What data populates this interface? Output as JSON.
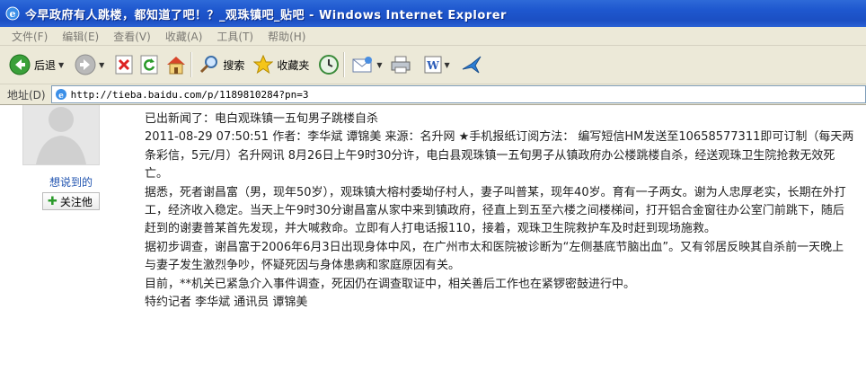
{
  "window": {
    "title": "今早政府有人跳楼，都知道了吧！？_观珠镇吧_贴吧 - Windows Internet Explorer"
  },
  "menu": [
    "文件(F)",
    "编辑(E)",
    "查看(V)",
    "收藏(A)",
    "工具(T)",
    "帮助(H)"
  ],
  "toolbar": {
    "back_label": "后退",
    "search_label": "搜索",
    "favorites_label": "收藏夹"
  },
  "address": {
    "label": "地址(D)",
    "url": "http://tieba.baidu.com/p/1189810284?pn=3"
  },
  "user": {
    "name": "想说到的",
    "follow_label": "关注他"
  },
  "post": {
    "lines": [
      "已出新闻了：电白观珠镇一五旬男子跳楼自杀",
      "2011-08-29 07:50:51 作者：李华斌 谭锦美 来源：名升网 ★手机报纸订阅方法： 编写短信HM发送至10658577311即可订制（每天两条彩信，5元/月）名升网讯 8月26日上午9时30分许，电白县观珠镇一五旬男子从镇政府办公楼跳楼自杀，经送观珠卫生院抢救无效死亡。",
      "据悉，死者谢昌富（男，现年50岁），观珠镇大榕村委坳仔村人，妻子叫普某，现年40岁。育有一子两女。谢为人忠厚老实，长期在外打工，经济收入稳定。当天上午9时30分谢昌富从家中来到镇政府，径直上到五至六楼之间楼梯间，打开铝合金窗往办公室门前跳下，随后赶到的谢妻普某首先发现，并大喊救命。立即有人打电话报110，接着，观珠卫生院救护车及时赶到现场施救。",
      "据初步调查，谢昌富于2006年6月3日出现身体中风，在广州市太和医院被诊断为“左侧基底节脑出血”。又有邻居反映其自杀前一天晚上与妻子发生激烈争吵，怀疑死因与身体患病和家庭原因有关。",
      "目前，**机关已紧急介入事件调查，死因仍在调查取证中，相关善后工作也在紧锣密鼓进行中。",
      "特约记者 李华斌 通讯员 谭锦美"
    ]
  },
  "colors": {
    "titlebar": "#1f58cf",
    "chrome": "#ece9d8",
    "link": "#2154b0"
  }
}
